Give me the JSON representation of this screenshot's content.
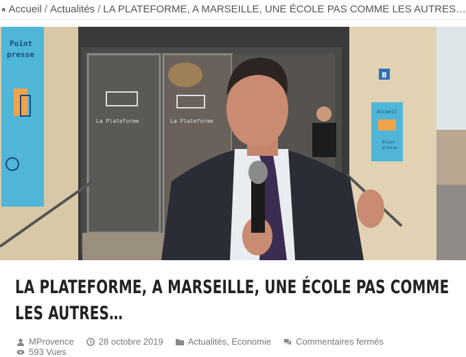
{
  "breadcrumb": {
    "home": "Accueil",
    "section": "Actualités",
    "current": "LA PLATEFORME, A MARSEILLE, UNE ÉCOLE PAS COMME LES AUTRES…",
    "separator": "/"
  },
  "hero": {
    "sign_left_line1": "Point",
    "sign_left_line2": "presse",
    "door_sign_left": "La Plateforme",
    "door_sign_right": "La Plateforme",
    "house_number": "8",
    "sign_right_line1": "Accueil",
    "sign_right_line2": "Point",
    "sign_right_line3": "presse"
  },
  "article": {
    "title": "LA PLATEFORME, A MARSEILLE, UNE ÉCOLE PAS COMME LES AUTRES…",
    "author": "MProvence",
    "date": "28 octobre 2019",
    "categories": "Actualités, Economie",
    "comments": "Commentaires fermés",
    "views": "593 Vues"
  }
}
